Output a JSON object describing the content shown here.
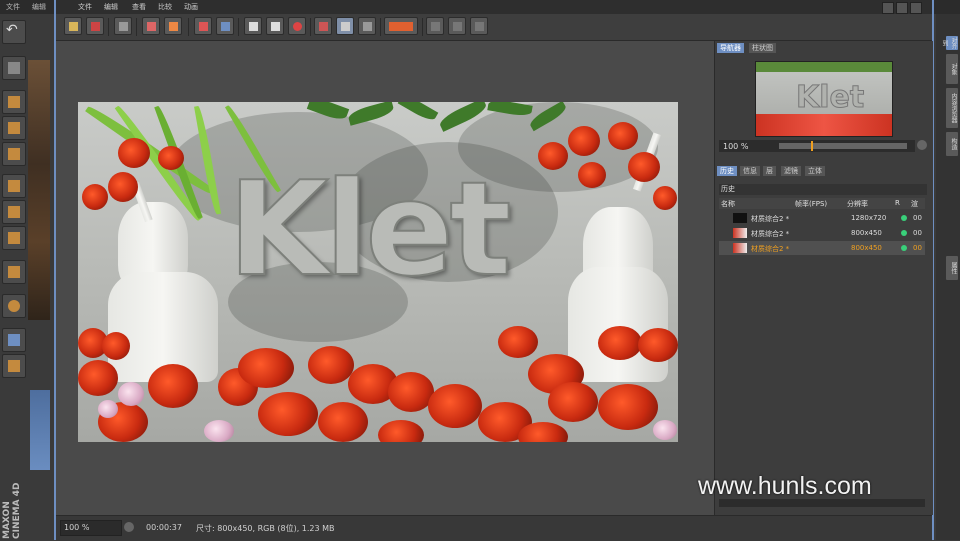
{
  "app_menu": {
    "file": "文件",
    "edit": "编辑"
  },
  "viewer": {
    "menu": [
      "文件",
      "编辑",
      "查看",
      "比较",
      "动画"
    ],
    "status": {
      "zoom": "100 %",
      "time": "00:00:37",
      "info": "尺寸: 800x450, RGB (8位), 1.23 MB"
    }
  },
  "render_image": {
    "text": "Klet"
  },
  "panel": {
    "tabs_top": [
      "导航器",
      "柱状图"
    ],
    "nav_zoom": "100 %",
    "tabs_mid": [
      "历史",
      "信息",
      "层",
      "滤镜",
      "立体"
    ],
    "history_title": "历史",
    "columns": [
      "名称",
      "帧率(FPS)",
      "分辨率",
      "R",
      "渲"
    ],
    "rows": [
      {
        "name": "材质综合2 *",
        "fps": "",
        "res": "1280x720",
        "pct": "00"
      },
      {
        "name": "材质综合2 *",
        "fps": "",
        "res": "800x450",
        "pct": "00"
      },
      {
        "name": "材质综合2 *",
        "fps": "",
        "res": "800x450",
        "pct": "00"
      }
    ]
  },
  "side_tabs": [
    "对齐到",
    "对象",
    "内容浏览器",
    "构造",
    "属性"
  ],
  "brand": "MAXON CINEMA 4D",
  "watermark": "www.hunls.com",
  "colors": {
    "accent": "#6e8fc2",
    "selected_row_text": "#f0a020",
    "status_dot": "#39d07a"
  }
}
